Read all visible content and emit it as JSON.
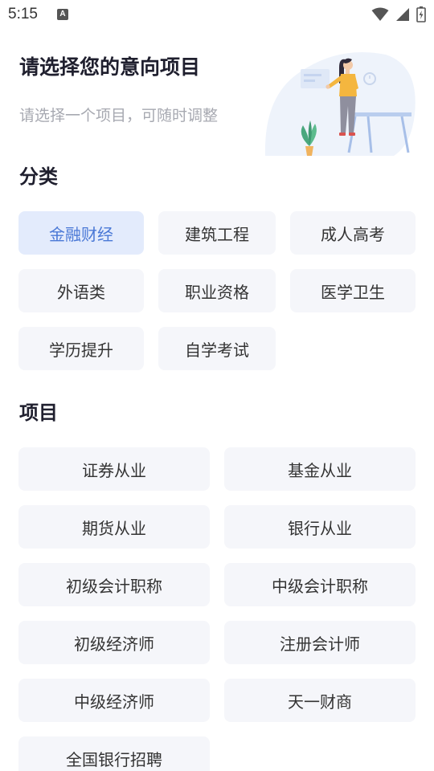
{
  "status_bar": {
    "time": "5:15",
    "notif_letter": "A"
  },
  "header": {
    "title": "请选择您的意向项目",
    "subtitle": "请选择一个项目，可随时调整"
  },
  "category_section": {
    "title": "分类",
    "items": [
      "金融财经",
      "建筑工程",
      "成人高考",
      "外语类",
      "职业资格",
      "医学卫生",
      "学历提升",
      "自学考试"
    ],
    "selected": "金融财经"
  },
  "project_section": {
    "title": "项目",
    "items": [
      "证券从业",
      "基金从业",
      "期货从业",
      "银行从业",
      "初级会计职称",
      "中级会计职称",
      "初级经济师",
      "注册会计师",
      "中级经济师",
      "天一财商",
      "全国银行招聘"
    ]
  },
  "colors": {
    "selected_bg": "#e3ebfc",
    "selected_text": "#4a78d6",
    "chip_bg": "#f5f6fa"
  }
}
